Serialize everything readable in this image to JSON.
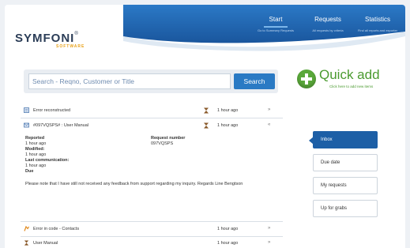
{
  "brand": {
    "name": "SYMFONI",
    "tagline": "SOFTWARE"
  },
  "nav": [
    {
      "label": "Start",
      "desc": "Go to Summary Requests",
      "active": true
    },
    {
      "label": "Requests",
      "desc": "All requests by criteria",
      "active": false
    },
    {
      "label": "Statistics",
      "desc": "Find all reports and exporter",
      "active": false
    }
  ],
  "search": {
    "placeholder": "Search - Reqno, Customer or Title",
    "button": "Search"
  },
  "quick_add": {
    "title": "Quick add",
    "hint": "Click here to add new items"
  },
  "requests": [
    {
      "title": "Error reconstructed",
      "time": "1 hour ago",
      "icon": "document-icon"
    },
    {
      "title": "#097VQSPS# : User Manual",
      "time": "1 hour ago",
      "icon": "mail-icon"
    },
    {
      "title": "Error in code - Contacts",
      "time": "1 hour ago",
      "icon": "bug-icon"
    },
    {
      "title": "User Manual",
      "time": "1 hour ago",
      "icon": "hourglass-icon"
    }
  ],
  "detail": {
    "reported_label": "Reported",
    "reported_value": "1 hour ago",
    "modified_label": "Modified:",
    "modified_value": "1 hour ago",
    "last_comm_label": "Last communication:",
    "last_comm_value": "1 hour ago",
    "due_label": "Due",
    "request_number_label": "Request number",
    "request_number_value": "097VQSPS",
    "message": "Please note that I have still not received any feedback from support regarding my inquiry. Regards Line Bengtson"
  },
  "menu": [
    {
      "label": "Inbox",
      "active": true
    },
    {
      "label": "Due date",
      "active": false
    },
    {
      "label": "My requests",
      "active": false
    },
    {
      "label": "Up for grabs",
      "active": false
    }
  ],
  "colors": {
    "header_blue": "#1f64ad",
    "accent_green": "#4a9a2f",
    "search_blue": "#2a7ac4"
  }
}
